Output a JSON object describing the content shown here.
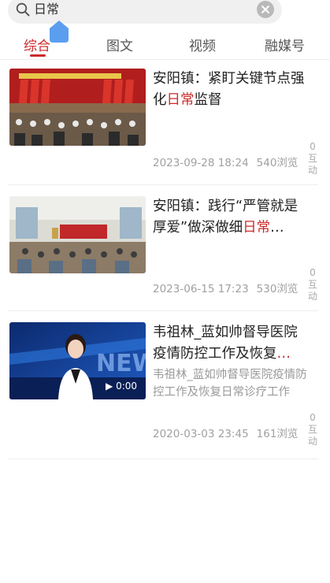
{
  "search": {
    "value": "日常"
  },
  "tabs": [
    {
      "label": "综合",
      "active": true
    },
    {
      "label": "图文",
      "active": false
    },
    {
      "label": "视频",
      "active": false
    },
    {
      "label": "融媒号",
      "active": false
    }
  ],
  "results": [
    {
      "title_pre": "安阳镇：紧盯关键节点强化",
      "title_hl": "日常",
      "title_post": "监督",
      "date": "2023-09-28 18:24",
      "views": "540浏览",
      "interactions": "0",
      "interactions_label": "互动"
    },
    {
      "title_pre": "安阳镇：践行“严管就是厚爱”做深做细",
      "title_hl": "日常",
      "title_post": "…",
      "date": "2023-06-15 17:23",
      "views": "530浏览",
      "interactions": "0",
      "interactions_label": "互动"
    },
    {
      "title_pre": "韦祖林_蓝如帅督导医院疫情防控工作及恢复",
      "title_post": "…",
      "summary": "韦祖林_蓝如帅督导医院疫情防控工作及恢复日常诊疗工作",
      "video_duration": "0:00",
      "video_text": "NEW",
      "date": "2020-03-03 23:45",
      "views": "161浏览",
      "interactions": "0",
      "interactions_label": "互动"
    }
  ],
  "colors": {
    "accent": "#cc2a2a",
    "meta_text": "#a0a0a0",
    "cursor_handle": "#5b9ef0"
  }
}
